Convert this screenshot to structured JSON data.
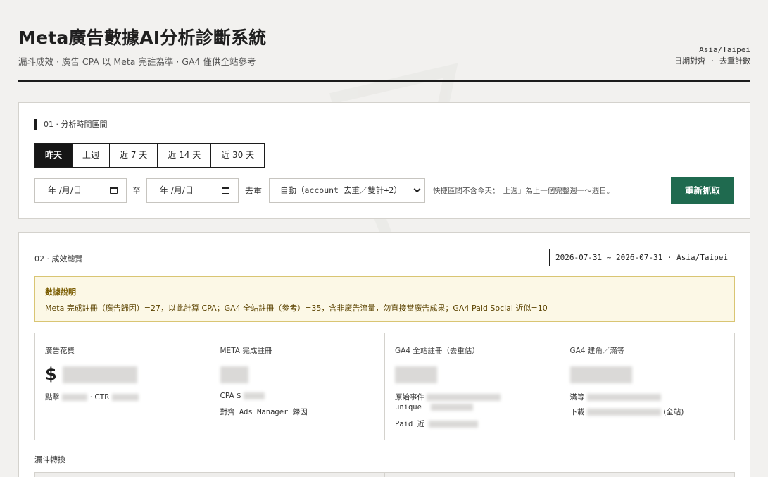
{
  "header": {
    "title": "Meta廣告數據AI分析診斷系統",
    "subtitle": "漏斗成效 · 廣告 CPA 以 Meta 完註為準 · GA4 僅供全站參考",
    "timezone": "Asia/Taipei",
    "align_note": "日期對齊 · 去重計數"
  },
  "range_section": {
    "title": "01 · 分析時間區間",
    "tabs": [
      {
        "label": "昨天",
        "active": true
      },
      {
        "label": "上週",
        "active": false
      },
      {
        "label": "近 7 天",
        "active": false
      },
      {
        "label": "近 14 天",
        "active": false
      },
      {
        "label": "近 30 天",
        "active": false
      }
    ],
    "start_date": {
      "placeholder": "年 /月/日"
    },
    "to_label": "至",
    "end_date": {
      "placeholder": "年 /月/日"
    },
    "dedupe_label": "去重",
    "dedupe_select": {
      "value": "自動（account 去重／雙計÷2）"
    },
    "hint": "快捷區間不含今天；「上週」為上一個完整週一～週日。",
    "refresh_label": "重新抓取"
  },
  "overview": {
    "title": "02 · 成效總覽",
    "range_badge": "2026-07-31 ~ 2026-07-31 · Asia/Taipei",
    "notice_title": "數據說明",
    "notice_text": "Meta 完成註冊（廣告歸因）=27，以此計算 CPA；GA4 全站註冊（參考）=35，含非廣告流量，勿直接當廣告成果；GA4 Paid Social 近似=10",
    "kpis": [
      {
        "label": "廣告花費",
        "big": "$",
        "lines": [
          "點擊",
          "· CTR"
        ]
      },
      {
        "label": "META 完成註冊",
        "big": "",
        "lines": [
          "CPA $",
          "對齊 Ads Manager 歸因"
        ]
      },
      {
        "label": "GA4 全站註冊（去重估）",
        "big": "",
        "lines": [
          "原始事件",
          "unique_",
          "Paid 近"
        ]
      },
      {
        "label": "GA4 建角／滿等",
        "big": "",
        "lines": [
          "滿等",
          "下載",
          "(全站)"
        ]
      }
    ],
    "funnel_title": "漏斗轉換"
  }
}
